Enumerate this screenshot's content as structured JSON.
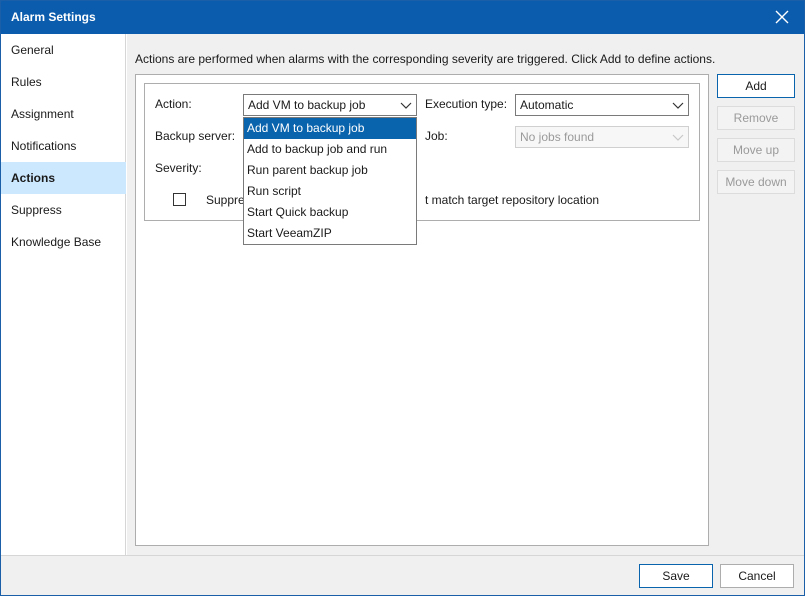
{
  "window": {
    "title": "Alarm Settings"
  },
  "sidebar": {
    "items": [
      {
        "label": "General"
      },
      {
        "label": "Rules"
      },
      {
        "label": "Assignment"
      },
      {
        "label": "Notifications"
      },
      {
        "label": "Actions"
      },
      {
        "label": "Suppress"
      },
      {
        "label": "Knowledge Base"
      }
    ],
    "active": "Actions"
  },
  "main": {
    "description": "Actions are performed when alarms with the corresponding severity are triggered. Click Add to define actions.",
    "form": {
      "action_label": "Action:",
      "action_value": "Add VM to backup job",
      "execution_type_label": "Execution type:",
      "execution_type_value": "Automatic",
      "backup_server_label": "Backup server:",
      "job_label": "Job:",
      "job_value": "No jobs found",
      "severity_label": "Severity:",
      "suppress_prefix": "Suppre",
      "suppress_suffix": "t match target repository location"
    },
    "action_options": [
      "Add VM to backup job",
      "Add to backup job and run",
      "Run parent backup job",
      "Run script",
      "Start Quick backup",
      "Start VeeamZIP"
    ],
    "buttons": {
      "add": "Add",
      "remove": "Remove",
      "move_up": "Move up",
      "move_down": "Move down"
    }
  },
  "footer": {
    "save": "Save",
    "cancel": "Cancel"
  },
  "colors": {
    "titlebar": "#0b5cad",
    "selection": "#0a64ad",
    "active_sidebar": "#cce8ff"
  }
}
